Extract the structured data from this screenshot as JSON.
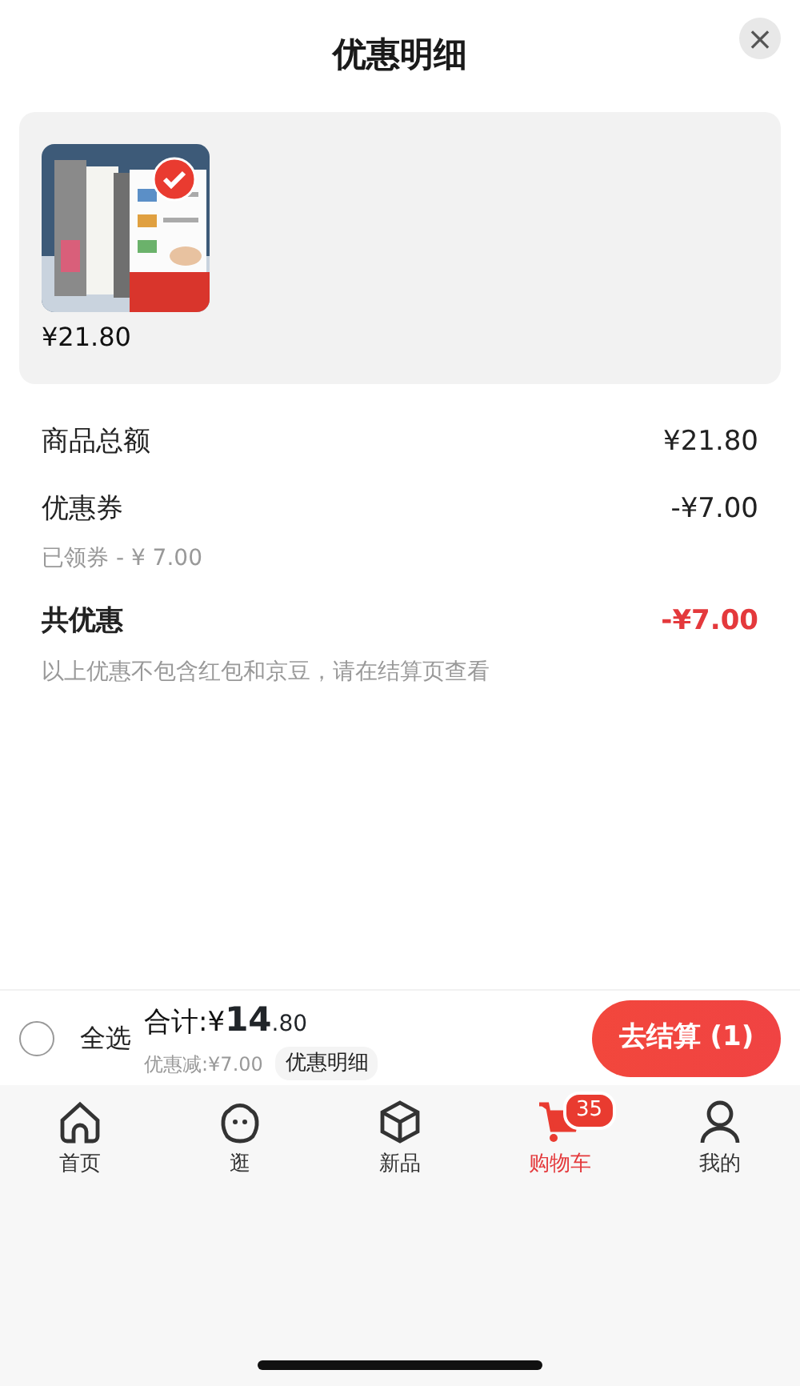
{
  "sheet": {
    "title": "优惠明细",
    "close": "×"
  },
  "products": [
    {
      "selected": true,
      "price": "¥21.80"
    }
  ],
  "lines": [
    {
      "kind": "normal",
      "label": "商品总额",
      "amount": "¥21.80"
    },
    {
      "kind": "normal",
      "label": "优惠券",
      "amount": "-¥7.00",
      "note": "已领券 - ¥ 7.00"
    },
    {
      "kind": "total",
      "label": "共优惠",
      "amount": "-¥7.00",
      "note": "以上优惠不包含红包和京豆，请在结算页查看"
    }
  ],
  "cart_bar": {
    "select_all": {
      "label": "全选",
      "checked": false
    },
    "total_label": "合计:",
    "currency": "¥",
    "total_int": "14",
    "total_dec": ".80",
    "discount": "优惠减:¥7.00",
    "detail_link": "优惠明细",
    "checkout": "去结算 (1)"
  },
  "tabs": [
    {
      "kind": "home",
      "label": "首页",
      "selected": false
    },
    {
      "kind": "face",
      "label": "逛",
      "selected": false
    },
    {
      "kind": "box",
      "label": "新品",
      "selected": false
    },
    {
      "kind": "cart",
      "label": "购物车",
      "selected": true,
      "badge": "35"
    },
    {
      "kind": "person",
      "label": "我的",
      "selected": false
    }
  ]
}
